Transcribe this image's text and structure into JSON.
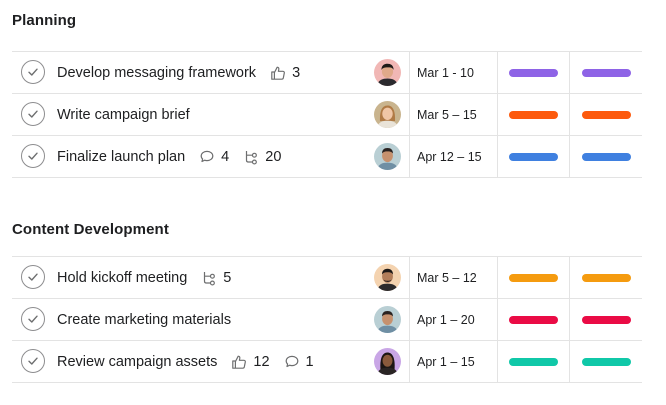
{
  "sections": [
    {
      "title": "Planning",
      "tasks": [
        {
          "name": "Develop messaging framework",
          "likes": "3",
          "date": "Mar 1 - 10",
          "color": "#8e63e6",
          "avatar": "avatar-1"
        },
        {
          "name": "Write campaign brief",
          "date": "Mar 5 – 15",
          "color": "#fd5a0d",
          "avatar": "avatar-2"
        },
        {
          "name": "Finalize launch plan",
          "comments": "4",
          "subtasks": "20",
          "date": "Apr 12 – 15",
          "color": "#3f80e0",
          "avatar": "avatar-3"
        }
      ]
    },
    {
      "title": "Content Development",
      "tasks": [
        {
          "name": "Hold kickoff meeting",
          "subtasks": "5",
          "date": "Mar 5 – 12",
          "color": "#f59b0f",
          "avatar": "avatar-4"
        },
        {
          "name": "Create marketing materials",
          "date": "Apr 1 – 20",
          "color": "#ea0b45",
          "avatar": "avatar-5"
        },
        {
          "name": "Review campaign assets",
          "likes": "12",
          "comments": "1",
          "date": "Apr 1 – 15",
          "color": "#10c8a8",
          "avatar": "avatar-6"
        }
      ]
    }
  ]
}
